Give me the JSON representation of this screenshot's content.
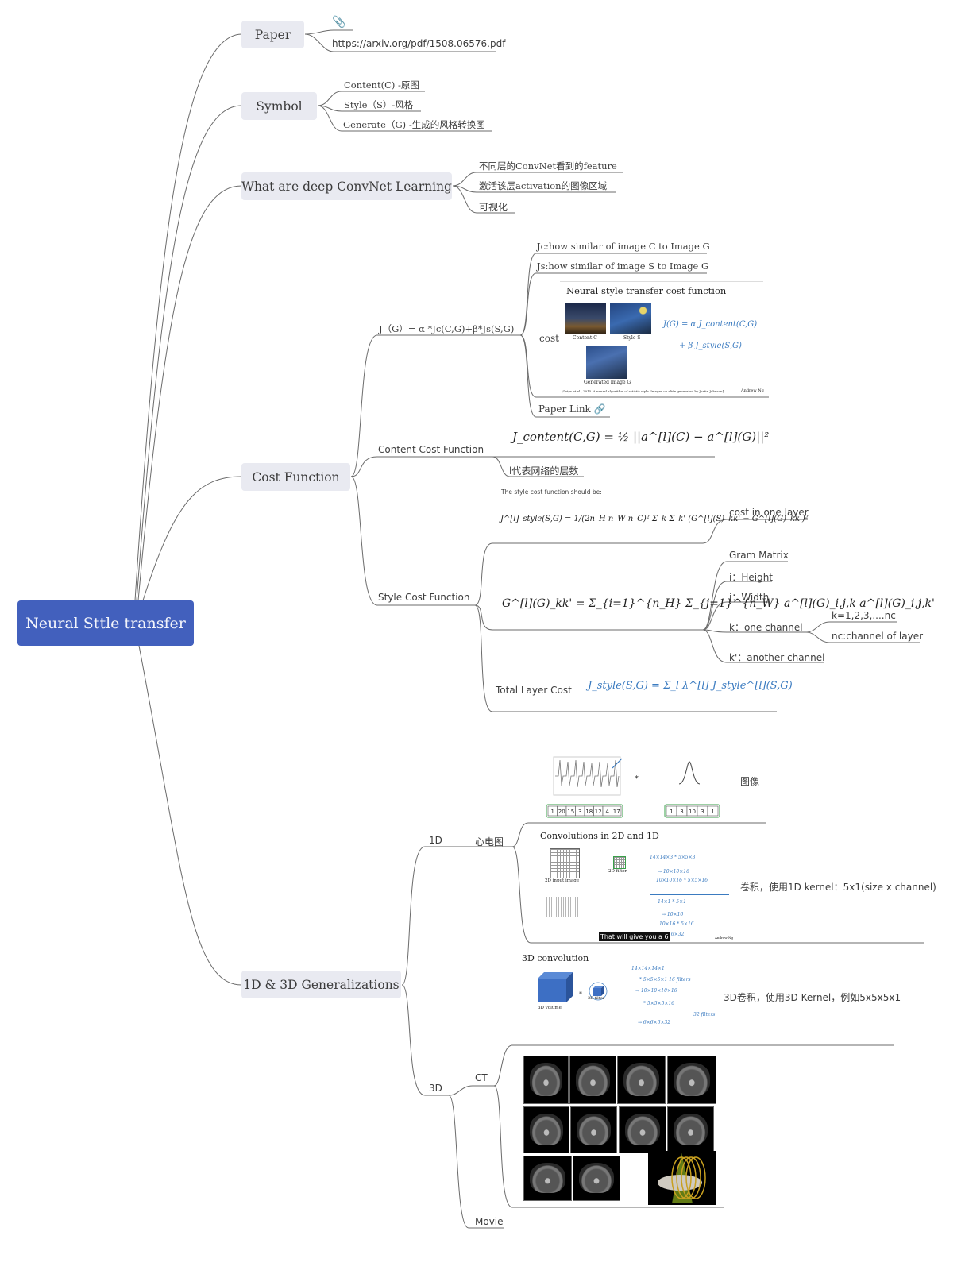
{
  "root": {
    "label": "Neural Sttle transfer"
  },
  "topics": {
    "paper": {
      "label": "Paper",
      "attachment_icon": "paperclip-icon",
      "url": "https://arxiv.org/pdf/1508.06576.pdf"
    },
    "symbol": {
      "label": "Symbol",
      "items": [
        "Content(C) -原图",
        "Style（S）-风格",
        "Generate（G) -生成的风格转换图"
      ]
    },
    "convnet": {
      "label": "What are deep ConvNet Learning",
      "items": [
        "不同层的ConvNet看到的feature",
        "激活该层activation的图像区域",
        "可视化"
      ]
    },
    "cost": {
      "label": "Cost Function",
      "jg": {
        "label": "J（G）= α *Jc(C,G)+β*Js(S,G)",
        "items": [
          "Jc:how  similar of image C to Image G",
          "Js:how  similar of image S to Image G"
        ],
        "cost_label": "cost",
        "slide": {
          "title": "Neural style transfer cost function",
          "content_caption": "Content C",
          "style_caption": "Style S",
          "generated_caption": "Generated image G",
          "citation": "[Gatys et al., 2015. A neural algorithm of artistic style. Images on slide generated by Justin Johnson]",
          "author": "Andrew Ng",
          "handwriting_1": "J(G) = α J_content(C,G)",
          "handwriting_2": "+ β J_style(S,G)"
        },
        "paper_link": "Paper Link",
        "link_icon": "link-icon"
      },
      "content": {
        "label": "Content Cost Function",
        "formula": "J_content(C,G) = ½ ||a^[l](C) − a^[l](G)||²",
        "note": "l代表网络的层数"
      },
      "style": {
        "label": "Style Cost Function",
        "intro": "The style cost function should be:",
        "formula_layer": "J^[l]_style(S,G) = 1/(2n_H n_W n_C)² Σ_k Σ_k' (G^[l](S)_kk' − G^[l](G)_kk')²",
        "layer_note": "cost in one layer",
        "gram_formula": "G^[l](G)_kk' = Σ_{i=1}^{n_H} Σ_{j=1}^{n_W} a^[l](G)_i,j,k a^[l](G)_i,j,k'",
        "gram_items": [
          "Gram Matrix",
          "i：Height",
          "j：Width",
          "k：one channel",
          "k'：another channel"
        ],
        "k_items": [
          "k=1,2,3,....nc",
          "nc:channel of layer"
        ],
        "total_label": "Total Layer Cost",
        "total_formula": "J_style(S,G) = Σ_l λ^[l] J_style^[l](S,G)"
      }
    },
    "gen": {
      "label": "1D & 3D Generalizations",
      "d1": {
        "label": "1D",
        "ecg": "心电图",
        "image_label": "图像",
        "ecg_signal": [
          "1",
          "20",
          "15",
          "3",
          "18",
          "12",
          "4",
          "17"
        ],
        "kernel": [
          "1",
          "3",
          "10",
          "3",
          "1"
        ],
        "slide_title": "Convolutions in 2D and 1D",
        "input_caption": "2D input image",
        "input_size": "14 x 14",
        "filter_caption": "2D filter",
        "filter_size": "5 x 5",
        "hand_lines": [
          "14×14×3  *  5×5×3",
          "→ 10×10×16",
          "10×10×16  *  5×5×16",
          "14×1  *  5×1",
          "→ 10×16",
          "10×16  *  5×16",
          "→ 6×32"
        ],
        "subtitle": "That will give you a 6",
        "author": "Andrew Ng",
        "desc": "卷积，使用1D kernel：5x1(size x channel)"
      },
      "d3": {
        "label": "3D",
        "conv_title": "3D convolution",
        "volume_caption": "3D volume",
        "filter_caption": "3D filter",
        "hand_lines": [
          "14×14×14×1",
          "* 5×5×5×1   16 filters",
          "→ 10×10×10×16",
          "* 5×5×5×16",
          "32 filters",
          "→ 6×6×6×32"
        ],
        "desc": "3D卷积，使用3D Kernel，例如5x5x5x1",
        "ct": "CT",
        "movie": "Movie"
      }
    }
  },
  "colors": {
    "root": "#4260bd",
    "main_topic": "#e9eaf1",
    "line": "#6b6b6b",
    "handwriting": "#3b7bc0",
    "green": "#3aa04a"
  }
}
